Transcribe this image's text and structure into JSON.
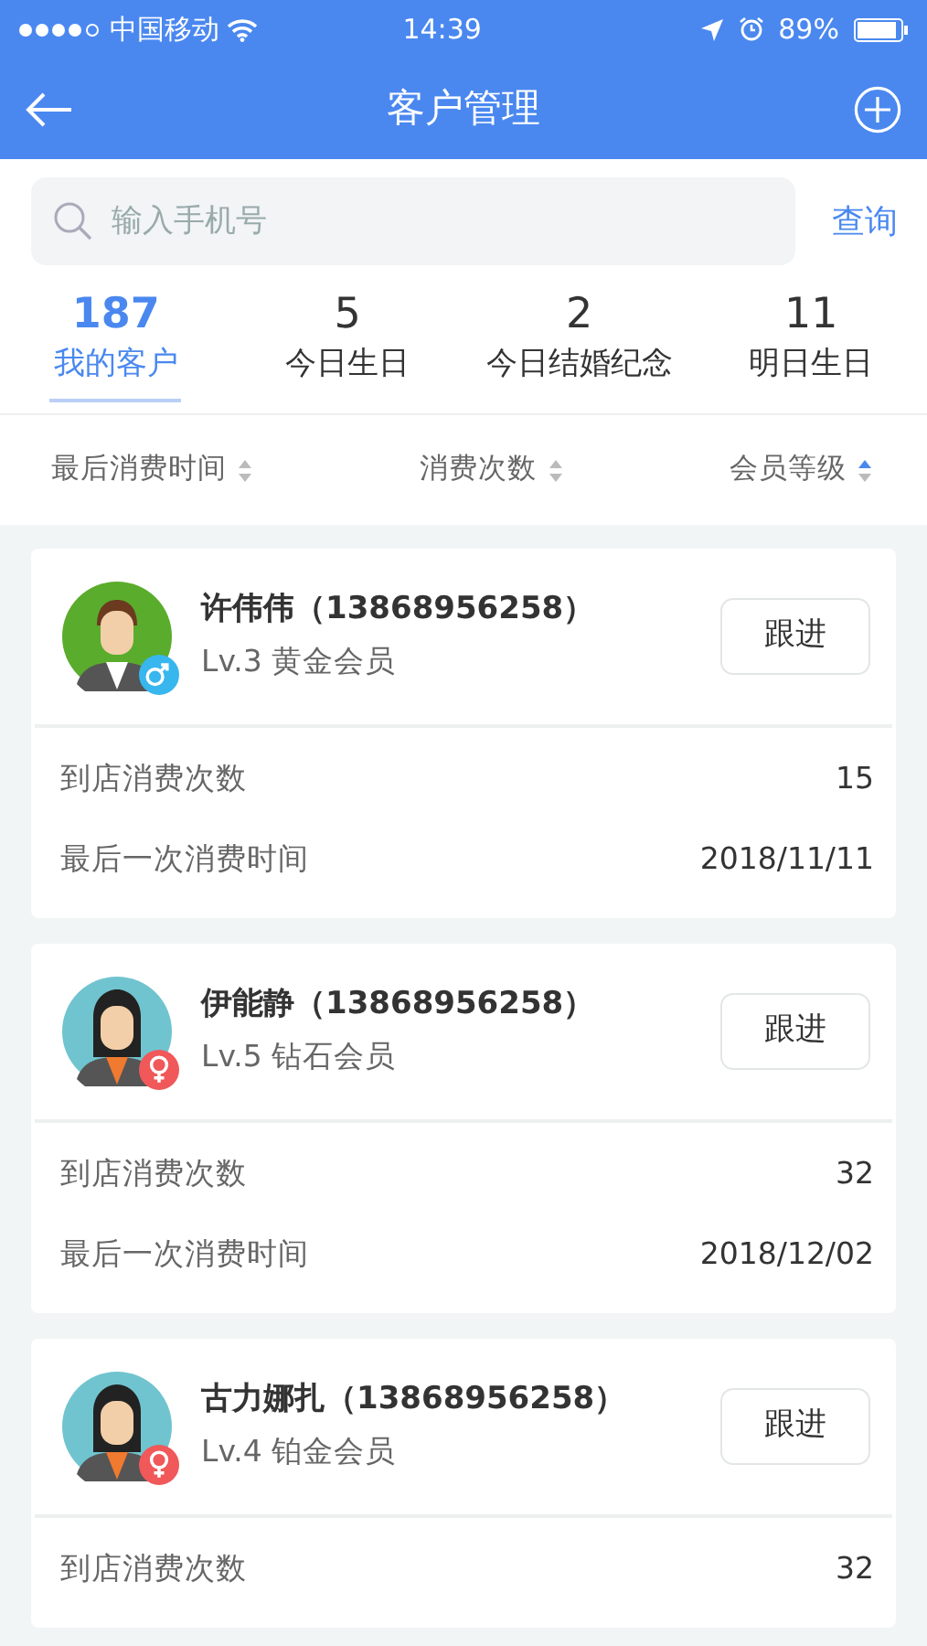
{
  "status_bar": {
    "carrier": "中国移动",
    "time": "14:39",
    "battery": "89%"
  },
  "nav_bar": {
    "title": "客户管理"
  },
  "search": {
    "placeholder": "输入手机号",
    "button": "查询"
  },
  "tabs": [
    {
      "count": "187",
      "label": "我的客户",
      "selected": true
    },
    {
      "count": "5",
      "label": "今日生日",
      "selected": false
    },
    {
      "count": "2",
      "label": "今日结婚纪念",
      "selected": false
    },
    {
      "count": "11",
      "label": "明日生日",
      "selected": false
    }
  ],
  "sort_options": [
    {
      "label": "最后消费时间",
      "active": false
    },
    {
      "label": "消费次数",
      "active": false
    },
    {
      "label": "会员等级",
      "active": true
    }
  ],
  "customers": [
    {
      "name": "许伟伟（13868956258）",
      "level": "Lv.3 黄金会员",
      "kind": "male",
      "button": "跟进",
      "stats": [
        {
          "label": "到店消费次数",
          "value": "15"
        },
        {
          "label": "最后一次消费时间",
          "value": "2018/11/11"
        }
      ]
    },
    {
      "name": "伊能静（13868956258）",
      "level": "Lv.5 钻石会员",
      "kind": "female",
      "button": "跟进",
      "stats": [
        {
          "label": "到店消费次数",
          "value": "32"
        },
        {
          "label": "最后一次消费时间",
          "value": "2018/12/02"
        }
      ]
    },
    {
      "name": "古力娜扎（13868956258）",
      "level": "Lv.4 铂金会员",
      "kind": "female",
      "button": "跟进",
      "stats": [
        {
          "label": "到店消费次数",
          "value": "32"
        }
      ]
    }
  ]
}
